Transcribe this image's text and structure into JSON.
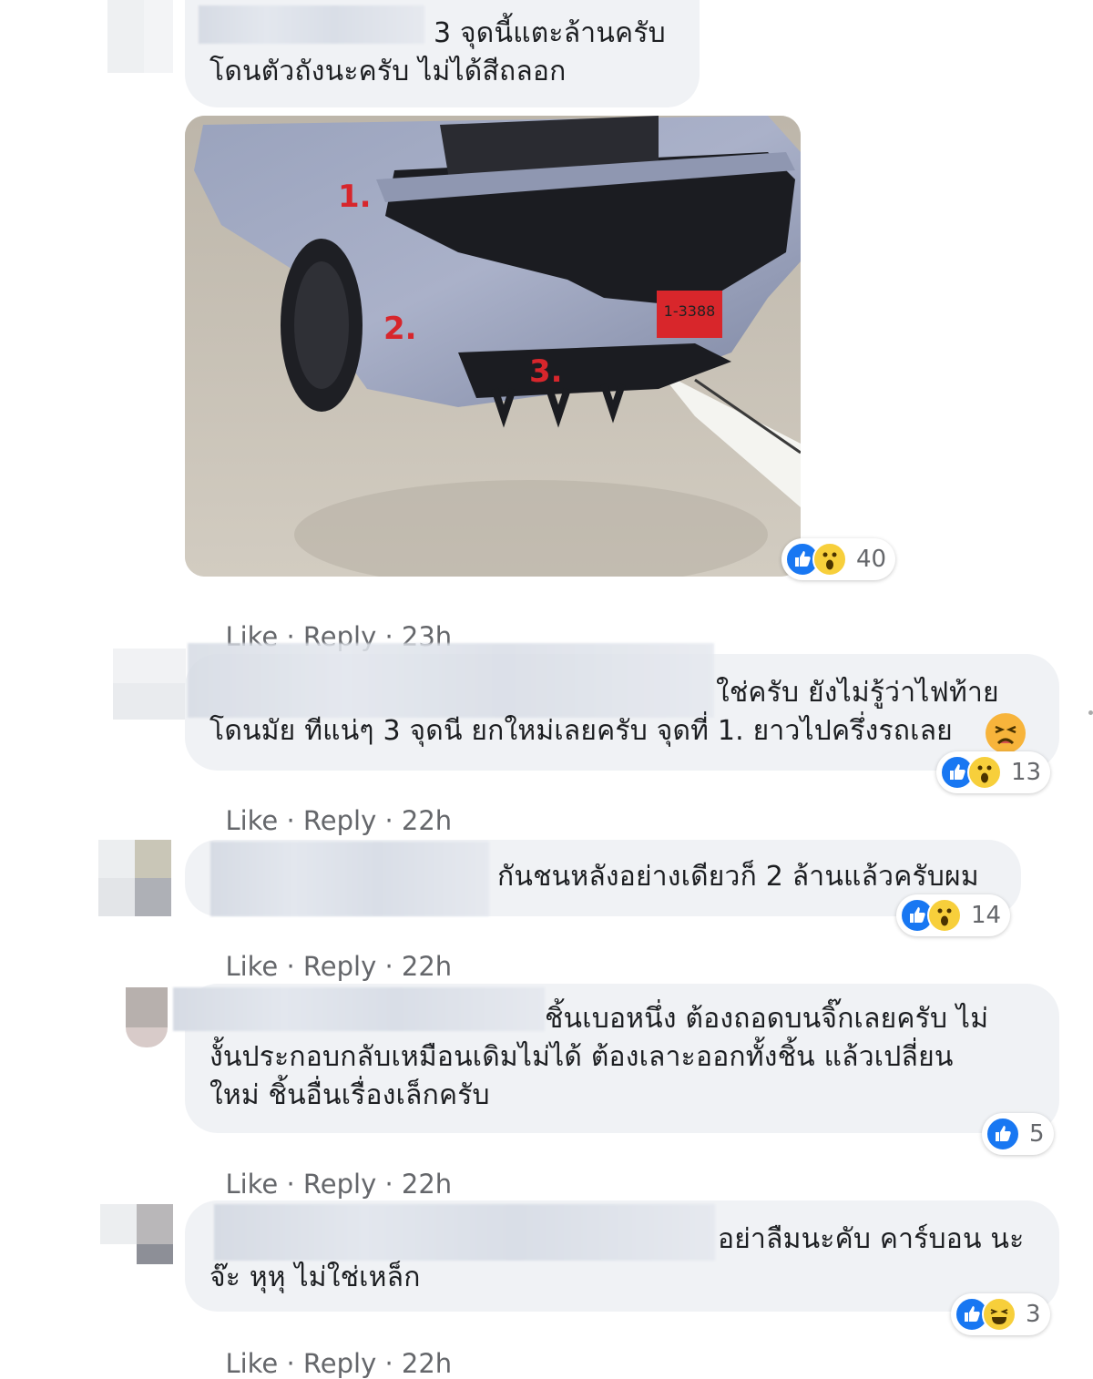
{
  "comments": [
    {
      "text_lines": [
        "3 จุดนี้แตะล้านครับ",
        "โดนตัวถังนะครับ ไม่ได้สีถลอก"
      ],
      "photo": {
        "labels": [
          "1.",
          "2.",
          "3."
        ],
        "plate": "1-3388"
      },
      "reaction_count": "40",
      "like_label": "Like",
      "reply_label": "Reply",
      "time": "23h"
    },
    {
      "text_lines": [
        "ใช่ครับ ยังไม่รู้ว่าไฟท้าย",
        "โดนมัย ทีแน่ๆ 3 จุดนี ยกใหม่เลยครับ จุดที่ 1. ยาวไปครึ่งรถเลย"
      ],
      "reaction_count": "13",
      "like_label": "Like",
      "reply_label": "Reply",
      "time": "22h"
    },
    {
      "text_lines": [
        "กันชนหลังอย่างเดียวก็ 2 ล้านแล้วครับผม"
      ],
      "reaction_count": "14",
      "like_label": "Like",
      "reply_label": "Reply",
      "time": "22h"
    },
    {
      "text_lines": [
        "ชิ้นเบอหนึ่ง ต้องถอดบนจิ๊กเลยครับ ไม่",
        "งั้นประกอบกลับเหมือนเดิมไม่ได้ ต้องเลาะออกทั้งชิ้น แล้วเปลี่ยน",
        "ใหม่ ชิ้นอื่นเรื่องเล็กครับ"
      ],
      "reaction_count": "5",
      "like_label": "Like",
      "reply_label": "Reply",
      "time": "22h"
    },
    {
      "text_lines": [
        "อย่าลืมนะคับ คาร์บอน นะ",
        "จ๊ะ หุหุ ไม่ใช่เหล็ก"
      ],
      "reaction_count": "3",
      "like_label": "Like",
      "reply_label": "Reply",
      "time": "22h"
    }
  ],
  "colors": {
    "bubble": "#f0f2f5",
    "like_blue": "#1877f2",
    "emoji_yellow": "#f7cf3b",
    "meta_gray": "#65676b",
    "text": "#1c1e21"
  },
  "icons": [
    "like-icon",
    "wow-icon",
    "tired-icon",
    "haha-icon"
  ]
}
